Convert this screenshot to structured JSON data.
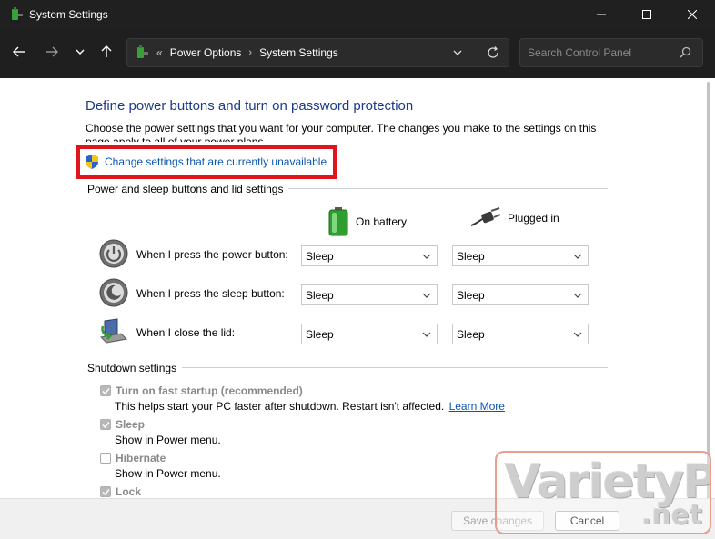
{
  "window": {
    "title": "System Settings"
  },
  "address": {
    "sep": "«",
    "crumbs": [
      "Power Options",
      "System Settings"
    ],
    "chev": "›"
  },
  "search": {
    "placeholder": "Search Control Panel"
  },
  "page": {
    "heading": "Define power buttons and turn on password protection",
    "description": "Choose the power settings that you want for your computer. The changes you make to the settings on this page apply to all of your power plans.",
    "change_link": "Change settings that are currently unavailable"
  },
  "power_buttons": {
    "group_label": "Power and sleep buttons and lid settings",
    "col_battery": "On battery",
    "col_plugged": "Plugged in",
    "rows": [
      {
        "label": "When I press the power button:",
        "battery": "Sleep",
        "plugged": "Sleep"
      },
      {
        "label": "When I press the sleep button:",
        "battery": "Sleep",
        "plugged": "Sleep"
      },
      {
        "label": "When I close the lid:",
        "battery": "Sleep",
        "plugged": "Sleep"
      }
    ]
  },
  "shutdown": {
    "group_label": "Shutdown settings",
    "items": [
      {
        "label": "Turn on fast startup (recommended)",
        "desc": "This helps start your PC faster after shutdown. Restart isn't affected.",
        "link": "Learn More",
        "checked": true
      },
      {
        "label": "Sleep",
        "desc": "Show in Power menu.",
        "checked": true
      },
      {
        "label": "Hibernate",
        "desc": "Show in Power menu.",
        "checked": false
      },
      {
        "label": "Lock",
        "checked": true
      }
    ]
  },
  "footer": {
    "save_label": "Save changes",
    "cancel_label": "Cancel"
  },
  "watermark": {
    "text": "VarietyPC",
    "suffix": ".net"
  },
  "colors": {
    "heading": "#1d3a8a",
    "link": "#0a55b5",
    "highlight": "#e0141b",
    "titlebar": "#202020"
  }
}
